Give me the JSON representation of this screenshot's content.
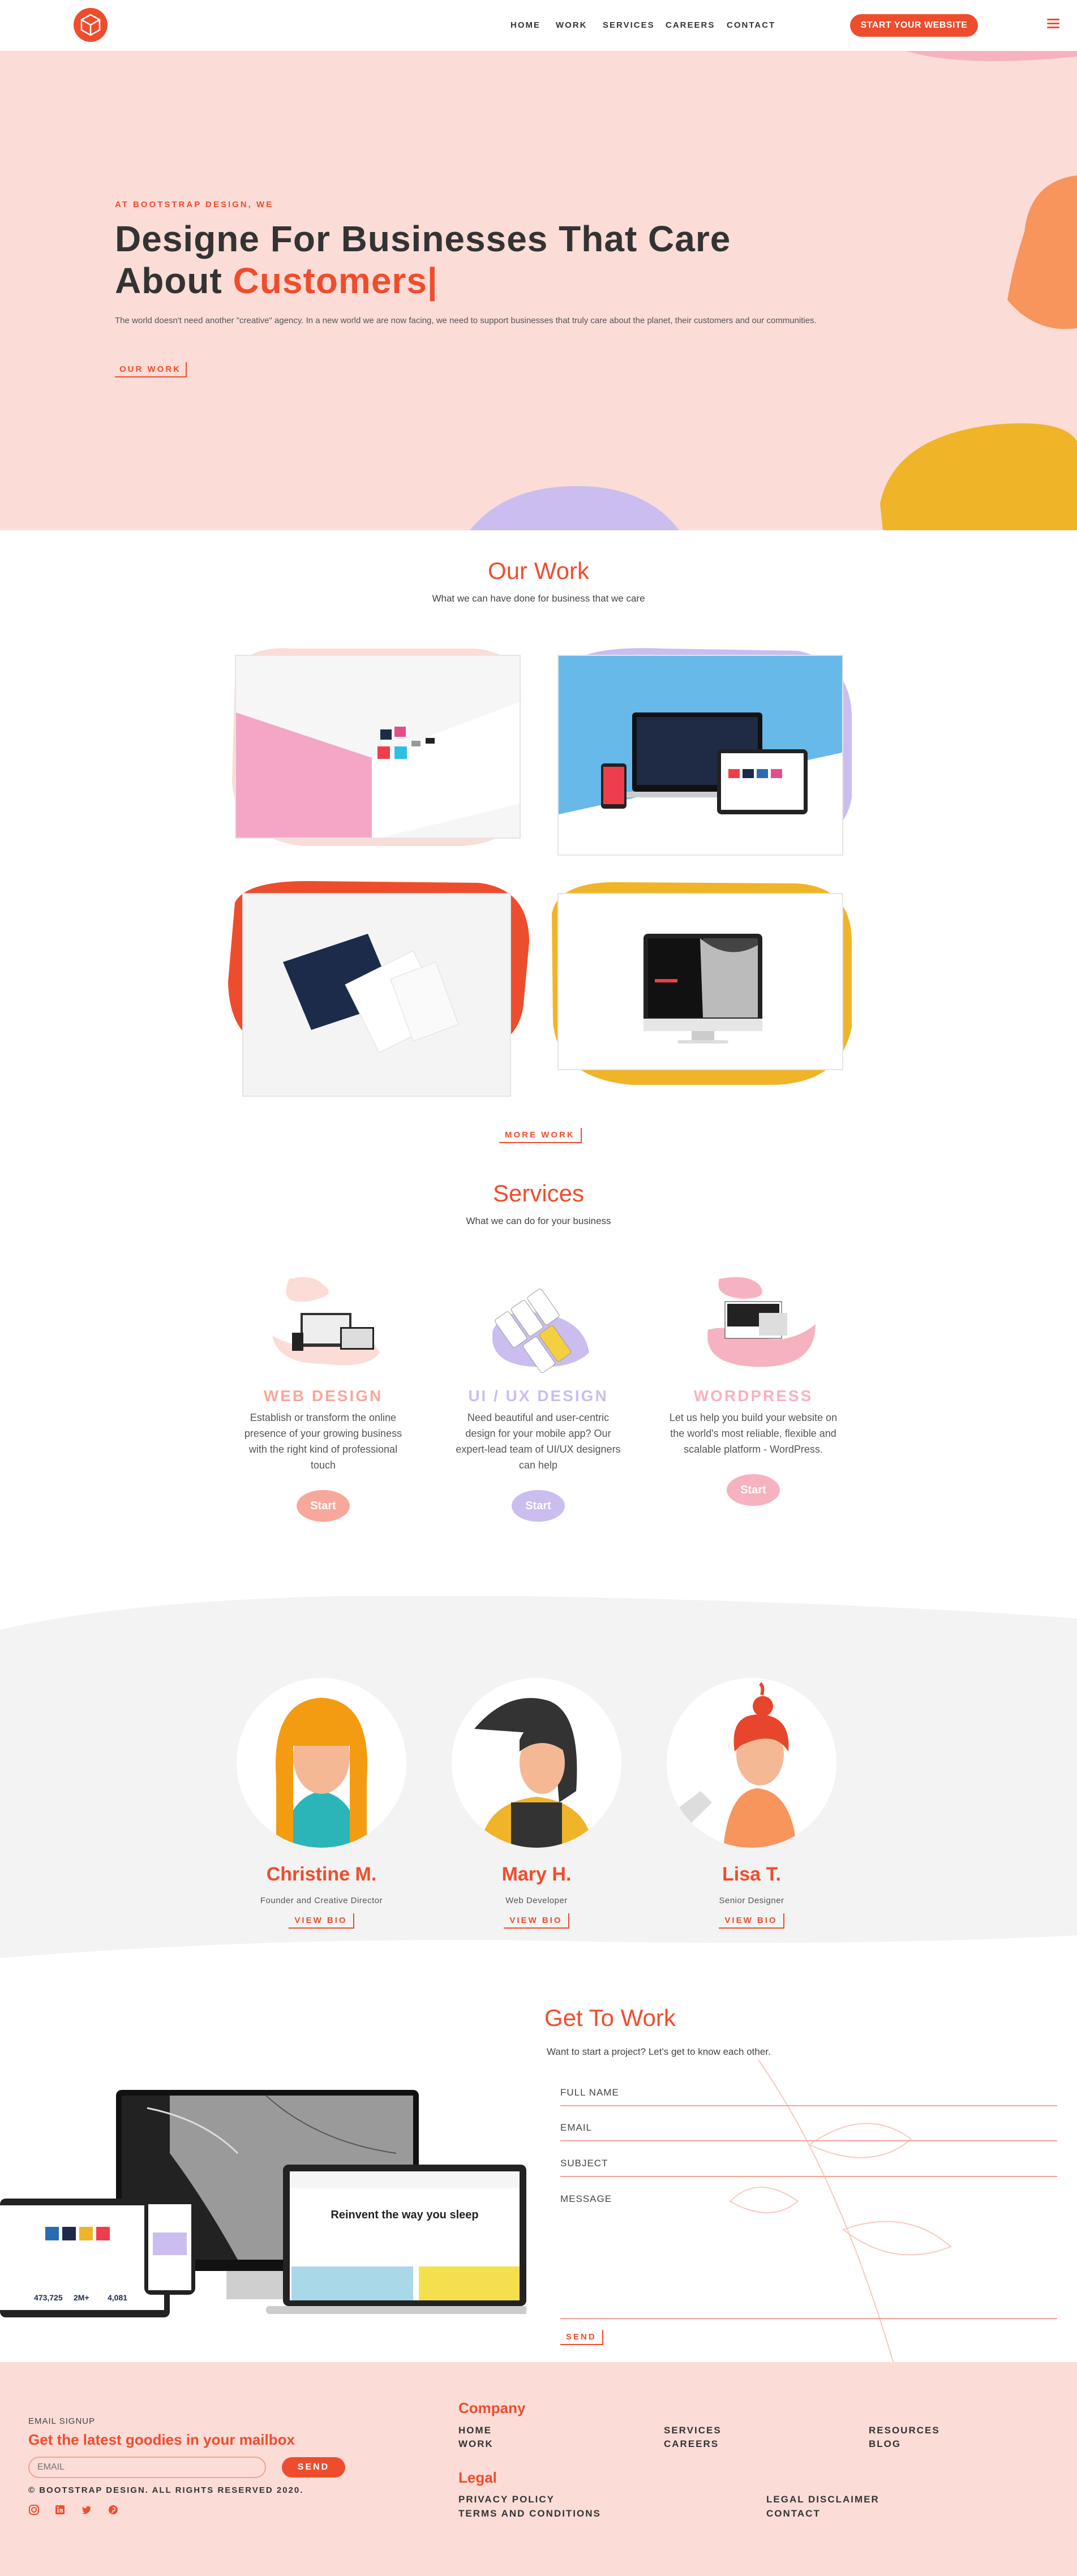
{
  "nav": {
    "links": [
      "HOME",
      "WORK",
      "SERVICES",
      "CAREERS",
      "CONTACT"
    ],
    "cta": "START YOUR WEBSITE",
    "logo_icon": "cube-logo-icon",
    "menu_icon": "hamburger-icon"
  },
  "hero": {
    "tagline": "AT BOOTSTRAP DESIGN, WE",
    "headline_1": "Designe For Businesses That Care",
    "headline_2": "About",
    "headline_highlight": "Customers|",
    "description": "The world doesn't need another \"creative\" agency. In a new world we are now facing, we need to support businesses that truly care about the planet, their customers and our communities.",
    "button": "OUR WORK"
  },
  "work": {
    "title": "Our Work",
    "subtitle": "What we can have done for business that we care",
    "more_button": "MORE WORK"
  },
  "services": {
    "title": "Services",
    "subtitle": "What we can do for your business",
    "items": [
      {
        "title": "WEB DESIGN",
        "desc": "Establish or transform the online presence of your growing business with the right kind of professional touch",
        "button": "Start",
        "color": "#f8a89a"
      },
      {
        "title": "UI / UX DESIGN",
        "desc": "Need beautiful and user-centric design for your mobile app? Our expert-lead team of UI/UX designers can help",
        "button": "Start",
        "color": "#cbbdf0"
      },
      {
        "title": "WORDPRESS",
        "desc": "Let us help you build your website on the world's most reliable, flexible and scalable platform - WordPress.",
        "button": "Start",
        "color": "#f7b2bf"
      }
    ]
  },
  "team": {
    "members": [
      {
        "name": "Christine M.",
        "role": "Founder and Creative Director",
        "button": "VIEW BIO"
      },
      {
        "name": "Mary H.",
        "role": "Web Developer",
        "button": "VIEW BIO"
      },
      {
        "name": "Lisa T.",
        "role": "Senior Designer",
        "button": "VIEW BIO"
      }
    ]
  },
  "contact": {
    "title": "Get To Work",
    "subtitle": "Want to start a project? Let's get to know each other.",
    "fields": {
      "name": "FULL NAME",
      "email": "EMAIL",
      "subject": "SUBJECT",
      "message": "MESSAGE"
    },
    "send": "SEND",
    "mockup_headline": "Reinvent the way you sleep",
    "mockup_stats": [
      "473,725",
      "2M+",
      "4,081"
    ]
  },
  "footer": {
    "signup_label": "EMAIL SIGNUP",
    "signup_title": "Get the latest goodies in your mailbox",
    "email_placeholder": "EMAIL",
    "send": "SEND",
    "copyright": "© BOOTSTRAP DESIGN. ALL RIGHTS RESERVED 2020.",
    "company_title": "Company",
    "company_links": [
      "HOME",
      "WORK",
      "SERVICES",
      "CAREERS",
      "RESOURCES",
      "BLOG"
    ],
    "legal_title": "Legal",
    "legal_links": [
      "PRIVACY POLICY",
      "TERMS AND CONDITIONS",
      "LEGAL DISCLAIMER",
      "CONTACT"
    ],
    "social_icons": [
      "instagram-icon",
      "linkedin-icon",
      "twitter-icon",
      "pinterest-icon"
    ]
  },
  "colors": {
    "accent": "#ee4d2d",
    "hero_bg": "#fbdcd7",
    "yellow": "#f0b429",
    "lavender": "#cbbdf0",
    "orange": "#f7955c"
  }
}
